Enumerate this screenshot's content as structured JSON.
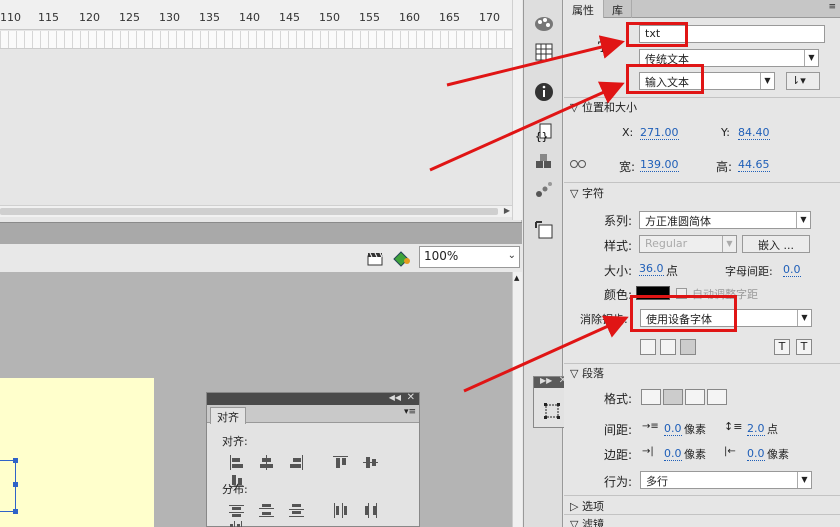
{
  "timeline": {
    "ruler_labels": [
      "110",
      "115",
      "120",
      "125",
      "130",
      "135",
      "140",
      "145",
      "150",
      "155",
      "160",
      "165",
      "170"
    ]
  },
  "stage": {
    "zoom": "100%"
  },
  "align_panel": {
    "tab": "对齐",
    "align_label": "对齐:",
    "distribute_label": "分布:"
  },
  "props": {
    "tabs": [
      "属性",
      "库"
    ],
    "instance_name": "txt",
    "text_engine": "传统文本",
    "text_type": "输入文本",
    "position_section": "位置和大小",
    "x_label": "X:",
    "x": "271.00",
    "y_label": "Y:",
    "y": "84.40",
    "w_label": "宽:",
    "w": "139.00",
    "h_label": "高:",
    "h": "44.65",
    "char_section": "字符",
    "family_label": "系列:",
    "family": "方正准圆简体",
    "style_label": "样式:",
    "style": "Regular",
    "embed": "嵌入 ...",
    "size_label": "大小:",
    "size": "36.0",
    "size_unit": "点",
    "spacing_label": "字母间距:",
    "spacing": "0.0",
    "color_label": "颜色:",
    "color_value": "#000000",
    "auto_kern": "自动调整字距",
    "aa_label": "消除锯齿:",
    "aa": "使用设备字体",
    "para_section": "段落",
    "format_label": "格式:",
    "gap_label": "间距:",
    "indent": "0.0",
    "indent_unit": "像素",
    "line_spacing": "2.0",
    "line_unit": "点",
    "margin_label": "边距:",
    "margin_left": "0.0",
    "margin_left_unit": "像素",
    "margin_right": "0.0",
    "margin_right_unit": "像素",
    "behavior_label": "行为:",
    "behavior": "多行",
    "options_section": "选项",
    "filter_section": "滤镜"
  },
  "colors": {
    "highlight": "#e01515",
    "stage_bg": "#ffffcc",
    "link_blue": "#1f5fb8"
  }
}
